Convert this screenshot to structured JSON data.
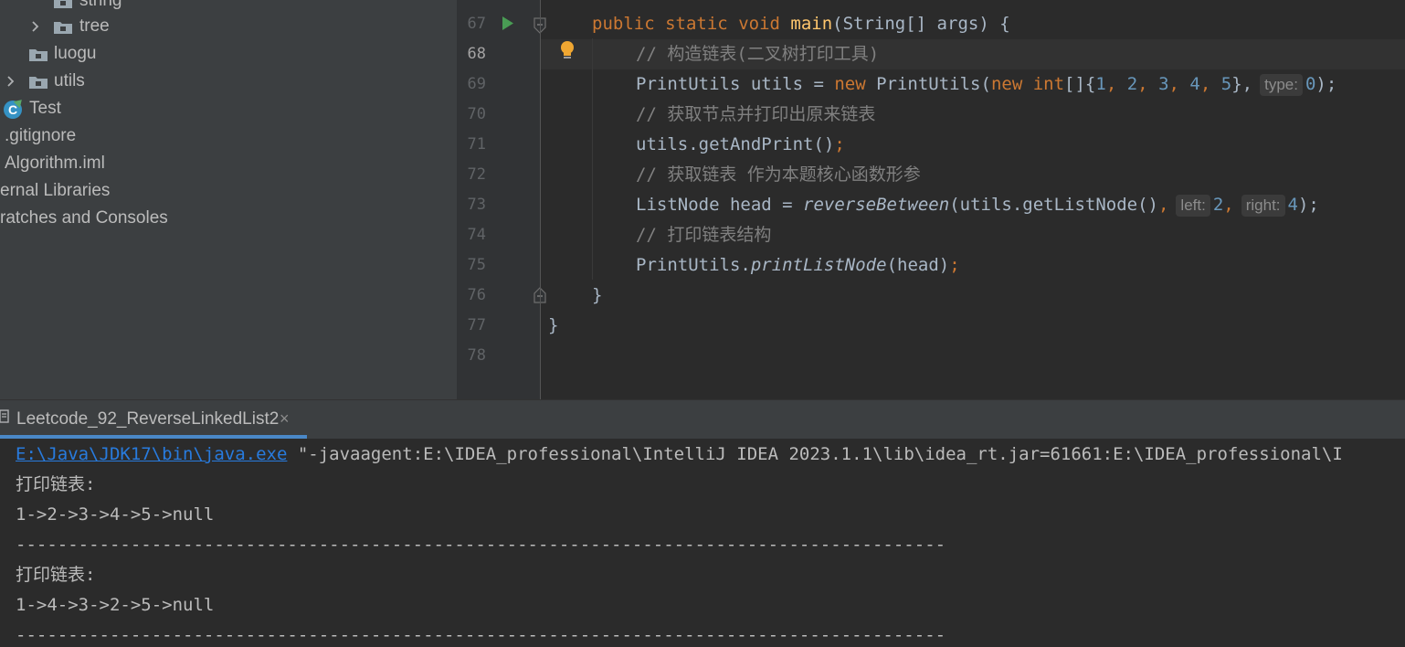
{
  "project_tree": {
    "items": [
      {
        "label": "string",
        "kind": "folder"
      },
      {
        "label": "tree",
        "kind": "folder",
        "expandable": true
      },
      {
        "label": "luogu",
        "kind": "folder"
      },
      {
        "label": "utils",
        "kind": "folder",
        "expandable": true
      },
      {
        "label": "Test",
        "kind": "class"
      },
      {
        "label": ".gitignore",
        "kind": "file"
      },
      {
        "label": "Algorithm.iml",
        "kind": "file"
      },
      {
        "label": "ernal Libraries",
        "kind": "group"
      },
      {
        "label": "ratches and Consoles",
        "kind": "group"
      }
    ],
    "class_icon_letter": "C"
  },
  "editor": {
    "line_numbers": [
      "67",
      "68",
      "69",
      "70",
      "71",
      "72",
      "73",
      "74",
      "75",
      "76",
      "77",
      "78"
    ],
    "current_line": "68",
    "code": {
      "l67": {
        "kw1": "public",
        "kw2": "static",
        "kw3": "void",
        "fn": "main",
        "rest": "(String[] args) {"
      },
      "l68": {
        "comment": "// 构造链表(二叉树打印工具)"
      },
      "l69": {
        "t1": "PrintUtils utils = ",
        "kw_new": "new",
        "t2": " PrintUtils(",
        "kw_new2": "new",
        "kw_int": " int",
        "t3": "[]{",
        "n1": "1",
        "n2": "2",
        "n3": "3",
        "n4": "4",
        "n5": "5",
        "sep": ", ",
        "t4": "},",
        "hint": "type:",
        "n6": "0",
        "t5": ");"
      },
      "l70": {
        "comment": "// 获取节点并打印出原来链表"
      },
      "l71": {
        "t1": "utils.getAndPrint()",
        "semi": ";"
      },
      "l72": {
        "comment": "// 获取链表 作为本题核心函数形参"
      },
      "l73": {
        "t1": "ListNode head = ",
        "fn_italic": "reverseBetween",
        "t2": "(utils.getListNode()",
        "comma": ",",
        "hint1": "left:",
        "n1": "2",
        "comma2": ",",
        "hint2": "right:",
        "n2": "4",
        "t3": ");"
      },
      "l74": {
        "comment": "// 打印链表结构"
      },
      "l75": {
        "t1": "PrintUtils.",
        "fn_italic": "printListNode",
        "t2": "(head)",
        "semi": ";"
      },
      "l76": {
        "brace": "}"
      },
      "l77": {
        "brace": "}"
      }
    }
  },
  "run_panel": {
    "tab_label": "Leetcode_92_ReverseLinkedList2",
    "close_glyph": "×",
    "console": {
      "java_path": "E:\\Java\\JDK17\\bin\\java.exe",
      "args": " \"-javaagent:E:\\IDEA_professional\\IntelliJ IDEA 2023.1.1\\lib\\idea_rt.jar=61661:E:\\IDEA_professional\\I",
      "lines": [
        "打印链表:",
        "1->2->3->4->5->null",
        "-----------------------------------------------------------------------------------------",
        "打印链表:",
        "1->4->3->2->5->null",
        "-----------------------------------------------------------------------------------------"
      ]
    }
  },
  "colors": {
    "keyword": "#cc7832",
    "function": "#ffc66d",
    "number": "#6897bb",
    "comment": "#808080",
    "link": "#287bde",
    "run_icon": "#499c54",
    "bulb": "#f0a732"
  }
}
